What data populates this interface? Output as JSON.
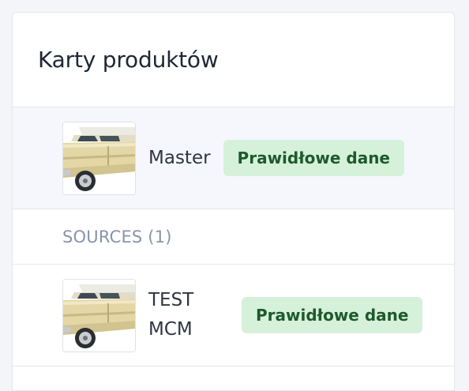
{
  "card": {
    "title": "Karty produktów"
  },
  "master": {
    "name": "Master",
    "status": "Prawidłowe dane"
  },
  "sources": {
    "label": "SOURCES (1)",
    "items": [
      {
        "name": "TEST\nMCM",
        "status": "Prawidłowe dane"
      }
    ]
  },
  "colors": {
    "badge_bg": "#d6f1da",
    "badge_text": "#1d5a2c",
    "master_row_bg": "#f5f7fd"
  }
}
